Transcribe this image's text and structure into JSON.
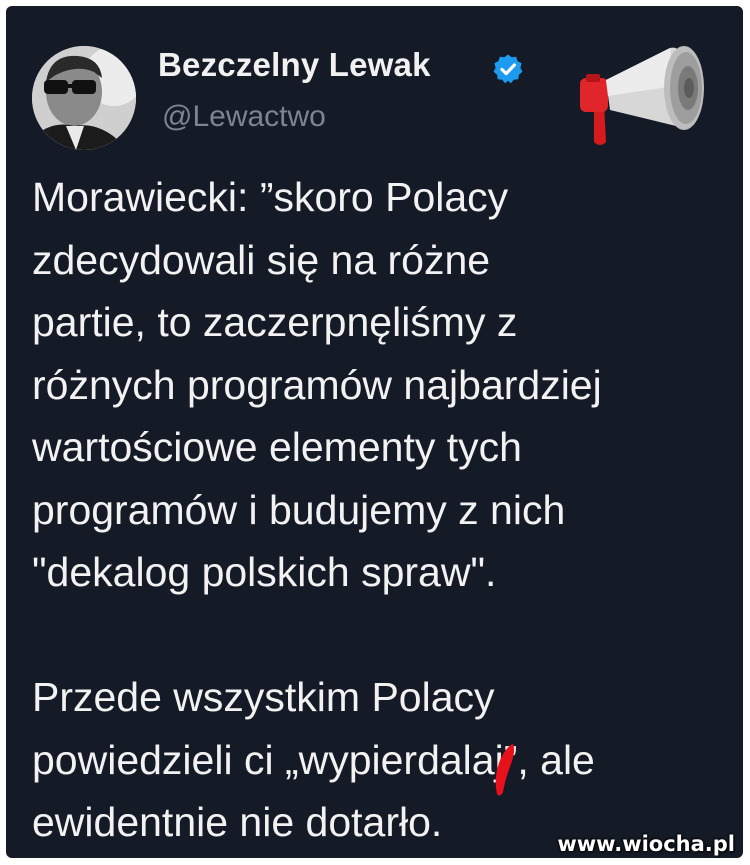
{
  "tweet": {
    "author_name": "Bezczelny Lewak",
    "author_handle": "@Lewactwo",
    "paragraph1": [
      "Morawiecki: ”skoro Polacy",
      "zdecydowali się na różne",
      "partie, to zaczerpnęliśmy z",
      "różnych programów najbardziej",
      "wartościowe elementy tych",
      "programów i budujemy z nich",
      "\"dekalog polskich spraw\"."
    ],
    "paragraph2": [
      "Przede wszystkim Polacy",
      "powiedzieli ci „wypierdalaj”, ale",
      "ewidentnie nie dotarło."
    ]
  },
  "icons": {
    "verified": "verified-badge-icon",
    "megaphone": "megaphone-icon"
  },
  "colors": {
    "background": "#151b26",
    "name_text": "#f1f1f1",
    "handle_text": "#7b8591",
    "verified_blue": "#1d9bf0",
    "censor_red": "#e8101a"
  },
  "watermark": "www.wiocha.pl"
}
